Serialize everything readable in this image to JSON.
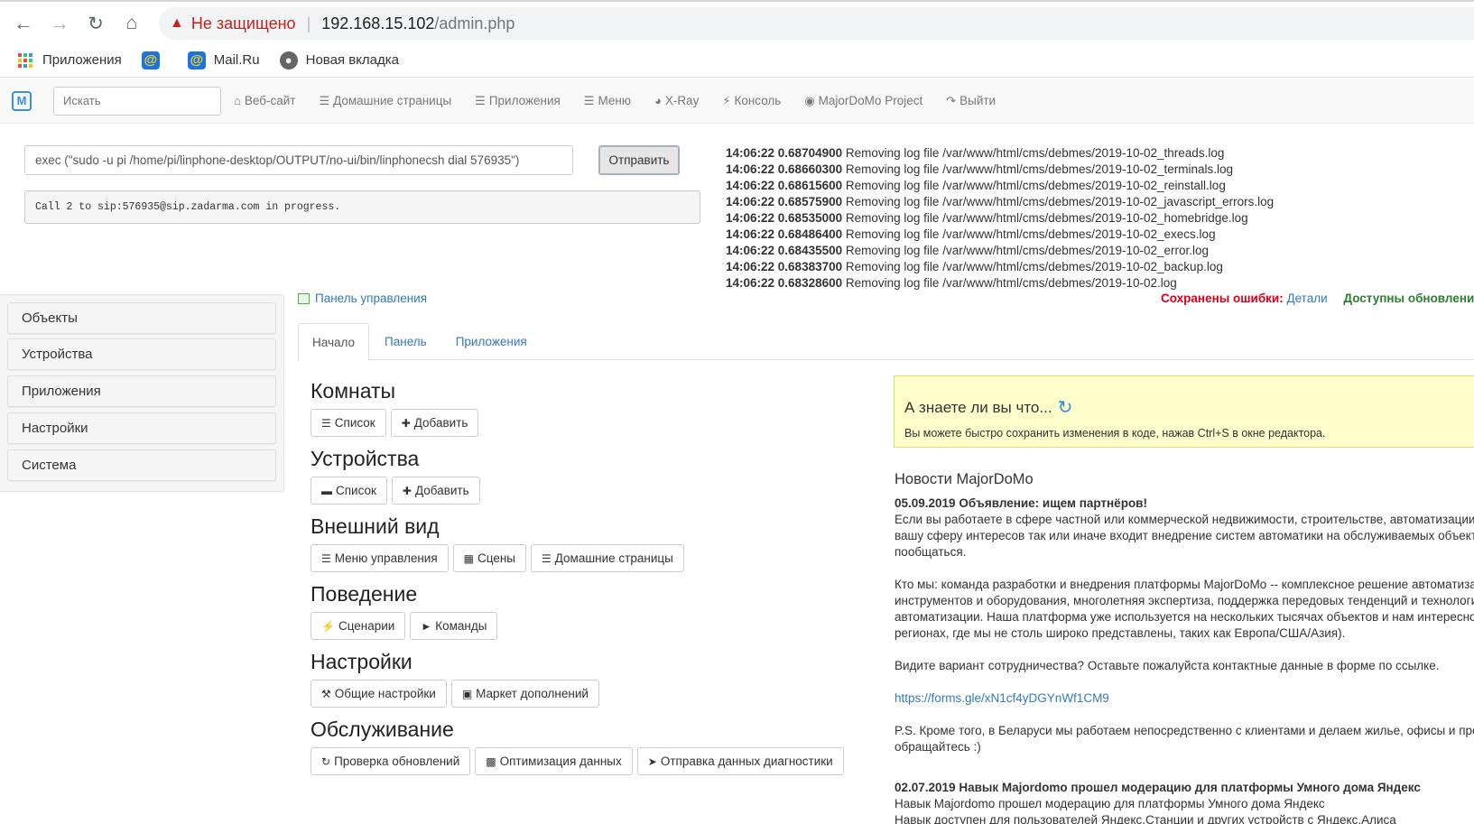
{
  "browser": {
    "security_label": "Не защищено",
    "url_host": "192.168.15.102",
    "url_path": "/admin.php",
    "bookmarks": [
      {
        "label": "Приложения"
      },
      {
        "label": ""
      },
      {
        "label": "Mail.Ru"
      },
      {
        "label": "Новая вкладка"
      }
    ]
  },
  "navbar": {
    "brand": "M",
    "search_placeholder": "Искать",
    "items": [
      {
        "label": "Веб-сайт"
      },
      {
        "label": "Домашние страницы"
      },
      {
        "label": "Приложения"
      },
      {
        "label": "Меню"
      },
      {
        "label": "X-Ray"
      },
      {
        "label": "Консоль"
      },
      {
        "label": "MajorDoMo Project"
      },
      {
        "label": "Выйти"
      }
    ]
  },
  "console": {
    "command": "exec (\"sudo -u pi /home/pi/linphone-desktop/OUTPUT/no-ui/bin/linphonecsh dial 576935\")",
    "send_label": "Отправить",
    "output": "Call 2 to sip:576935@sip.zadarma.com in progress."
  },
  "log": [
    {
      "time": "14:06:22 0.68704900",
      "msg": "Removing log file /var/www/html/cms/debmes/2019-10-02_threads.log"
    },
    {
      "time": "14:06:22 0.68660300",
      "msg": "Removing log file /var/www/html/cms/debmes/2019-10-02_terminals.log"
    },
    {
      "time": "14:06:22 0.68615600",
      "msg": "Removing log file /var/www/html/cms/debmes/2019-10-02_reinstall.log"
    },
    {
      "time": "14:06:22 0.68575900",
      "msg": "Removing log file /var/www/html/cms/debmes/2019-10-02_javascript_errors.log"
    },
    {
      "time": "14:06:22 0.68535000",
      "msg": "Removing log file /var/www/html/cms/debmes/2019-10-02_homebridge.log"
    },
    {
      "time": "14:06:22 0.68486400",
      "msg": "Removing log file /var/www/html/cms/debmes/2019-10-02_execs.log"
    },
    {
      "time": "14:06:22 0.68435500",
      "msg": "Removing log file /var/www/html/cms/debmes/2019-10-02_error.log"
    },
    {
      "time": "14:06:22 0.68383700",
      "msg": "Removing log file /var/www/html/cms/debmes/2019-10-02_backup.log"
    },
    {
      "time": "14:06:22 0.68328600",
      "msg": "Removing log file /var/www/html/cms/debmes/2019-10-02.log"
    }
  ],
  "breadcrumb": "Панель управления",
  "status": {
    "errors_label": "Сохранены ошибки:",
    "details_link": "Детали",
    "updates_label": "Доступны обновления"
  },
  "sidebar": {
    "items": [
      {
        "label": "Объекты"
      },
      {
        "label": "Устройства"
      },
      {
        "label": "Приложения"
      },
      {
        "label": "Настройки"
      },
      {
        "label": "Система"
      }
    ]
  },
  "tabs": [
    {
      "label": "Начало"
    },
    {
      "label": "Панель"
    },
    {
      "label": "Приложения"
    }
  ],
  "sections": [
    {
      "title": "Комнаты",
      "buttons": [
        {
          "label": "Список"
        },
        {
          "label": "Добавить"
        }
      ]
    },
    {
      "title": "Устройства",
      "buttons": [
        {
          "label": "Список"
        },
        {
          "label": "Добавить"
        }
      ]
    },
    {
      "title": "Внешний вид",
      "buttons": [
        {
          "label": "Меню управления"
        },
        {
          "label": "Сцены"
        },
        {
          "label": "Домашние страницы"
        }
      ]
    },
    {
      "title": "Поведение",
      "buttons": [
        {
          "label": "Сценарии"
        },
        {
          "label": "Команды"
        }
      ]
    },
    {
      "title": "Настройки",
      "buttons": [
        {
          "label": "Общие настройки"
        },
        {
          "label": "Маркет дополнений"
        }
      ]
    },
    {
      "title": "Обслуживание",
      "buttons": [
        {
          "label": "Проверка обновлений"
        },
        {
          "label": "Оптимизация данных"
        },
        {
          "label": "Отправка данных диагностики"
        }
      ]
    }
  ],
  "tip": {
    "title": "А знаете ли вы что...",
    "text": "Вы можете быстро сохранить изменения в коде, нажав Ctrl+S в окне редактора."
  },
  "news": {
    "heading": "Новости MajorDoMo",
    "item1_title": "05.09.2019 Объявление: ищем партнёров!",
    "item1_p1_l1": "Если вы работаете в сфере частной или коммерческой недвижимости, строительстве, автоматизации пр",
    "item1_p1_l2": "вашу сферу интересов так или иначе входит внедрение систем автоматики на обслуживаемых объектах",
    "item1_p1_l3": "пообщаться.",
    "item1_p2_l1": "Кто мы: команда разработки и внедрения платформы MajorDoMo -- комплексное решение автоматизац",
    "item1_p2_l2": "инструментов и оборудования, многолетняя экспертиза, поддержка передовых тенденций и технологий",
    "item1_p2_l3": "автоматизации. Наша платформа уже используется на нескольких тысячах объектов и нам интересно да",
    "item1_p2_l4": "регионах, где мы не столь широко представлены, таких как Европа/США/Азия).",
    "item1_p3": "Видите вариант сотрудничества? Оставьте пожалуйста контактные данные в форме по ссылке.",
    "item1_link": "https://forms.gle/xN1cf4yDGYnWf1CM9",
    "item1_p4_l1": "P.S. Кроме того, в Беларуси мы работаем непосредственно с клиентами и делаем жилье, офисы и произ",
    "item1_p4_l2": "обращайтесь :)",
    "item2_title": "02.07.2019 Навык Majordomo прошел модерацию для платформы Умного дома Яндекс",
    "item2_l1": "Навык Majordomo прошел модерацию для платформы Умного дома Яндекс",
    "item2_l2": "Навык доступен для пользователей Яндекс.Станции и других устройств с Яндекс.Алиса"
  }
}
